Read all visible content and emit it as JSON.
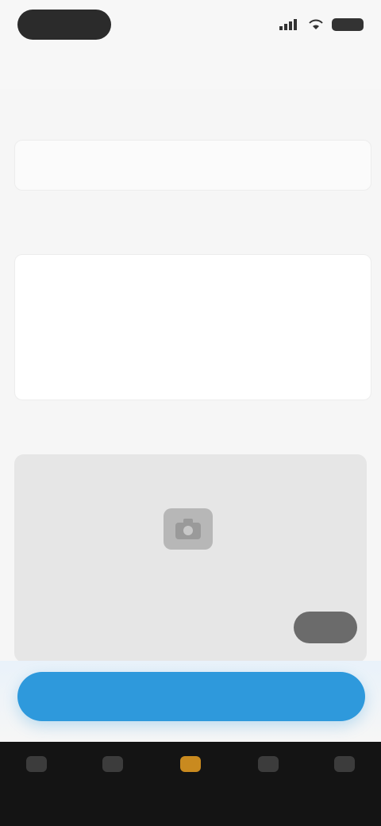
{
  "status_bar": {
    "time": "",
    "icons": [
      "signal-icon",
      "wifi-icon",
      "battery-icon"
    ]
  },
  "nav": {
    "back_label": "",
    "action_label": ""
  },
  "form": {
    "title_label": "",
    "title_value": "",
    "description_label": "",
    "description_placeholder": "",
    "photo_label": "",
    "photo_hint": "",
    "photo_subhint": "",
    "photo_chip_label": ""
  },
  "submit": {
    "label": ""
  },
  "tabbar": {
    "items": [
      {
        "label": "",
        "icon": "home-icon"
      },
      {
        "label": "",
        "icon": "grid-icon"
      },
      {
        "label": "",
        "icon": "plus-icon"
      },
      {
        "label": "",
        "icon": "chat-icon"
      },
      {
        "label": "",
        "icon": "profile-icon"
      }
    ],
    "active_index": 2
  },
  "colors": {
    "accent": "#f2a640",
    "primary": "#2e99dc",
    "tabbar": "#141414"
  }
}
